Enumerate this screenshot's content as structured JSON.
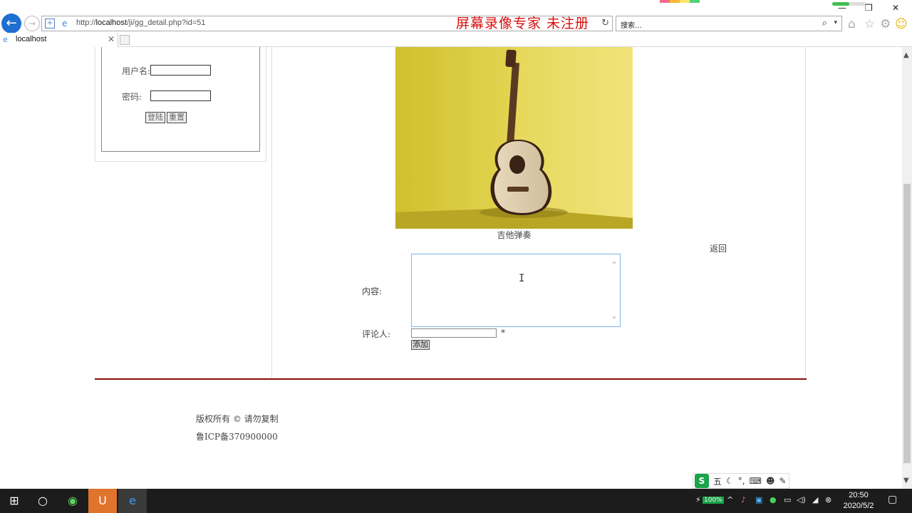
{
  "browser": {
    "url_prefix": "http://",
    "url_host": "localhost",
    "url_path": "/ji/gg_detail.php?id=51",
    "watermark": "屏幕录像专家 未注册",
    "search_placeholder": "搜索...",
    "tab_title": "localhost",
    "refresh_glyph": "↻"
  },
  "login": {
    "username_label": "用户名:",
    "password_label": "密码:",
    "login_button": "登陆",
    "reset_button": "重置"
  },
  "article": {
    "caption": "吉他弹奏",
    "back_link": "返回"
  },
  "comment_form": {
    "content_label": "内容:",
    "content_value": "",
    "commenter_label": "评论人:",
    "commenter_value": "",
    "required_mark": "*",
    "add_button": "添加"
  },
  "footer": {
    "copyright": "版权所有 © 请勿复制",
    "icp": "鲁ICP备370900000"
  },
  "ime": {
    "logo": "S",
    "mode": "五"
  },
  "taskbar": {
    "battery": "100%",
    "time": "20:50",
    "date": "2020/5/2"
  },
  "colors": {
    "divider": "#8b0a0a",
    "watermark": "#d80f0f",
    "accent": "#1e6fd0"
  }
}
